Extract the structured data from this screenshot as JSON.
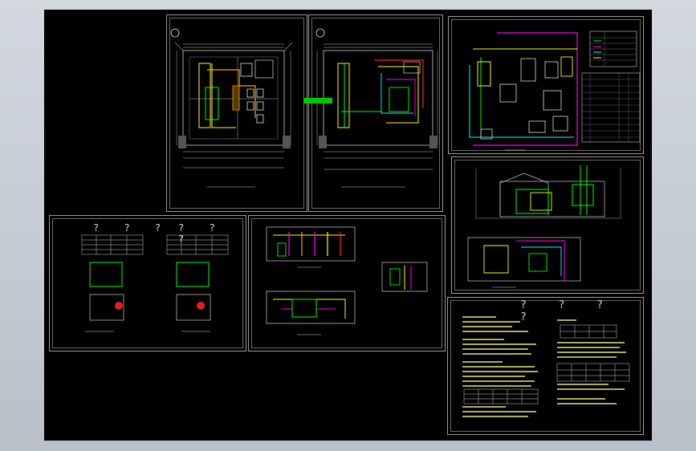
{
  "viewer": {
    "background_color": "#000000",
    "accent_colors": {
      "pipe_yellow": "#ffff00",
      "pipe_green": "#00ff00",
      "pipe_magenta": "#ff00ff",
      "pipe_cyan": "#00ffff",
      "pipe_red": "#ff2020",
      "line_white": "#e0e0e0",
      "frame_gray": "#9a9a9a"
    }
  },
  "sheets": {
    "plan_1": {
      "marker": "①"
    },
    "plan_2": {
      "marker": "①"
    },
    "equipment_table_1": {
      "title": "? ? ?"
    },
    "equipment_table_2": {
      "title": "? ? ?"
    },
    "notes": {
      "title": "? ? ? ?"
    }
  }
}
